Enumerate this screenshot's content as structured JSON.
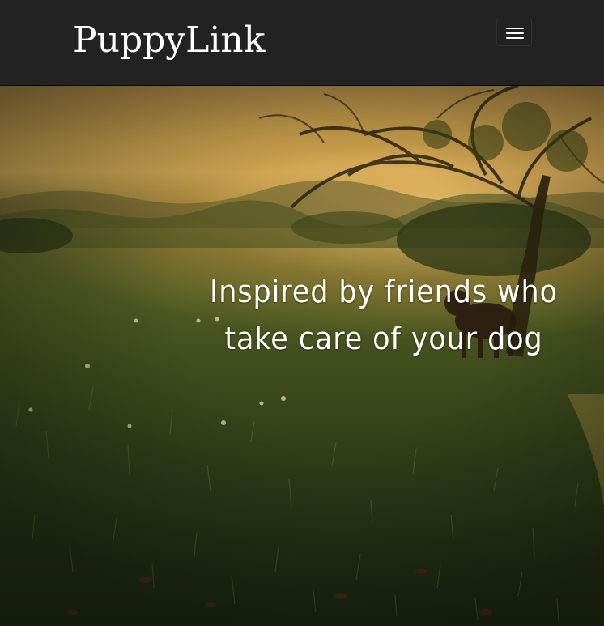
{
  "navbar": {
    "brand": "PuppyLink",
    "toggle_icon": "hamburger-menu-icon",
    "background_color": "#222222"
  },
  "hero": {
    "tagline": "Inspired by friends who take care of your dog",
    "image_description": "sunset-meadow-with-tree-and-dog"
  }
}
